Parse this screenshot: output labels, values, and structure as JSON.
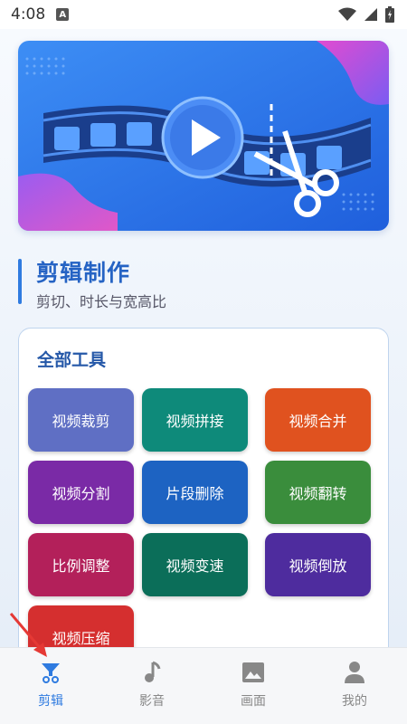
{
  "status_bar": {
    "time": "4:08",
    "notification_icon": "A"
  },
  "banner": {
    "icons": [
      "play-icon",
      "scissors-icon",
      "film-strip"
    ]
  },
  "section": {
    "title": "剪辑制作",
    "subtitle": "剪切、时长与宽高比"
  },
  "tools": {
    "title": "全部工具",
    "items": [
      {
        "label": "视频裁剪",
        "color": "#5f6fc4"
      },
      {
        "label": "视频拼接",
        "color": "#0e8a7a"
      },
      {
        "label": "视频合并",
        "color": "#e0521f"
      },
      {
        "label": "视频分割",
        "color": "#7a2aa6"
      },
      {
        "label": "片段删除",
        "color": "#1d63c2"
      },
      {
        "label": "视频翻转",
        "color": "#3a8d3c"
      },
      {
        "label": "比例调整",
        "color": "#b3205a"
      },
      {
        "label": "视频变速",
        "color": "#0b6e59"
      },
      {
        "label": "视频倒放",
        "color": "#4e2c9e"
      },
      {
        "label": "视频压缩",
        "color": "#d52f2f"
      }
    ]
  },
  "bottom_nav": {
    "items": [
      {
        "label": "剪辑",
        "icon": "edit-scissors-icon",
        "active": true
      },
      {
        "label": "影音",
        "icon": "music-note-icon",
        "active": false
      },
      {
        "label": "画面",
        "icon": "image-icon",
        "active": false
      },
      {
        "label": "我的",
        "icon": "person-icon",
        "active": false
      }
    ]
  },
  "colors": {
    "accent": "#2f7be0",
    "title": "#2563c4",
    "inactive": "#888888"
  }
}
